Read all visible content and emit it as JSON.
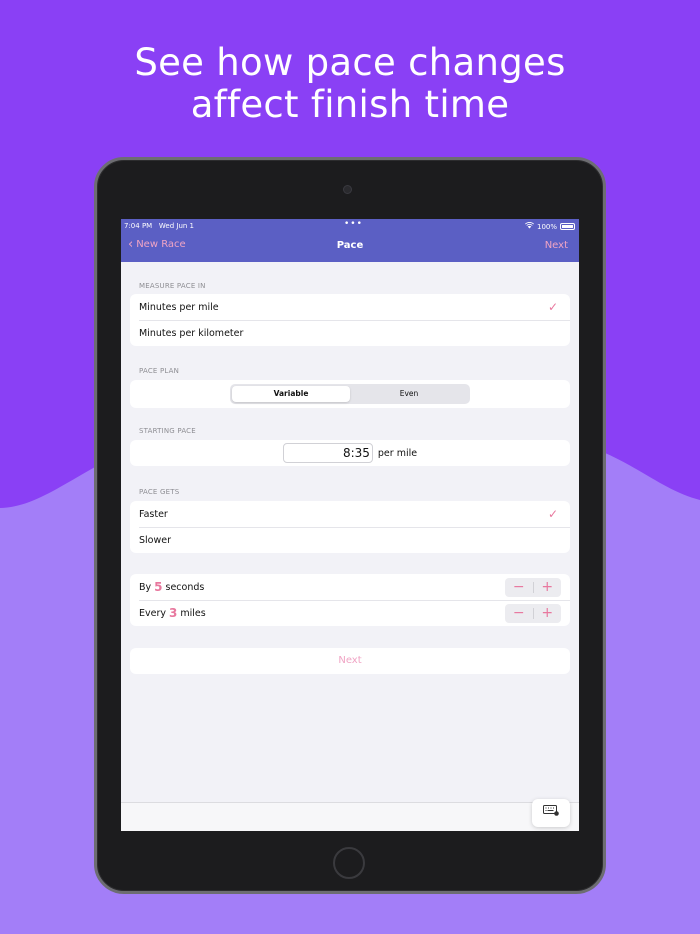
{
  "headline": {
    "line1": "See how pace changes",
    "line2": "affect finish time"
  },
  "status_bar": {
    "time": "7:04 PM",
    "date": "Wed Jun 1",
    "dots": "•••",
    "battery": "100%"
  },
  "navbar": {
    "back_label": "New Race",
    "title": "Pace",
    "next_label": "Next"
  },
  "measure": {
    "section": "MEASURE PACE IN",
    "options": [
      {
        "label": "Minutes per mile",
        "selected": true
      },
      {
        "label": "Minutes per kilometer",
        "selected": false
      }
    ]
  },
  "pace_plan": {
    "section": "PACE PLAN",
    "segments": [
      "Variable",
      "Even"
    ],
    "selected": "Variable"
  },
  "starting_pace": {
    "section": "STARTING PACE",
    "value": "8:35",
    "unit": "per mile"
  },
  "pace_gets": {
    "section": "PACE GETS",
    "options": [
      {
        "label": "Faster",
        "selected": true
      },
      {
        "label": "Slower",
        "selected": false
      }
    ]
  },
  "adjust": {
    "by": {
      "prefix": "By",
      "value": "5",
      "suffix": "seconds"
    },
    "every": {
      "prefix": "Every",
      "value": "3",
      "suffix": "miles"
    }
  },
  "next_button": "Next",
  "colors": {
    "background": "#8a40f5",
    "wave": "#a07af8",
    "navbar": "#5b5fc4",
    "accent": "#e8789e"
  },
  "icons": {
    "check": "checkmark-icon",
    "back": "chevron-left-icon",
    "keyboard": "keyboard-icon"
  }
}
